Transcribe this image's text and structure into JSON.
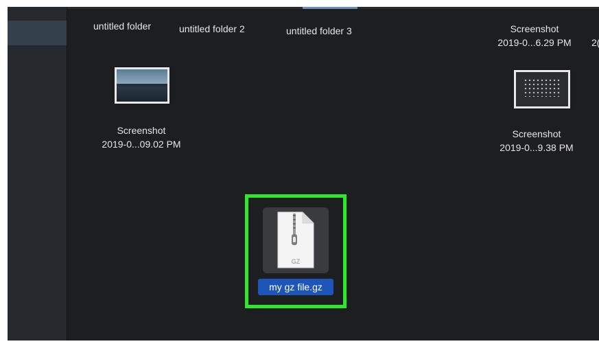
{
  "desktop_items": {
    "folder_1": {
      "name": "untitled folder"
    },
    "folder_2": {
      "name": "untitled folder 2"
    },
    "folder_3": {
      "name": "untitled folder 3"
    },
    "screenshot_top_right": {
      "name_line1": "Screenshot",
      "name_line2": "2019-0...6.29 PM"
    },
    "cut_off_label": {
      "text": "2("
    },
    "screenshot_left": {
      "name_line1": "Screenshot",
      "name_line2": "2019-0...09.02 PM"
    },
    "screenshot_right": {
      "name_line1": "Screenshot",
      "name_line2": "2019-0...9.38 PM"
    },
    "gz_file": {
      "name": "my gz file.gz",
      "extension_label": "GZ"
    }
  },
  "colors": {
    "background": "#1d1e20",
    "sidebar": "#262a2e",
    "selection_blue": "#1d55b8",
    "highlight_green": "#2ee82a"
  },
  "icons": {
    "gz_file": "archive-file-icon",
    "screenshot_thumbnails": "image-thumbnail-icon"
  }
}
